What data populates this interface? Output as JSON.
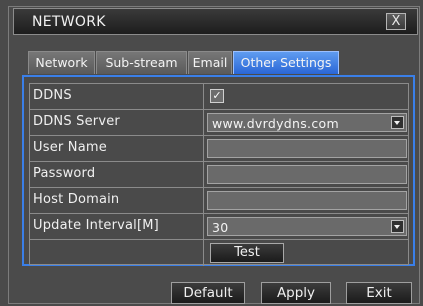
{
  "window": {
    "title": "NETWORK",
    "close_label": "X"
  },
  "tabs": [
    {
      "label": "Network",
      "active": false
    },
    {
      "label": "Sub-stream",
      "active": false
    },
    {
      "label": "Email",
      "active": false
    },
    {
      "label": "Other Settings",
      "active": true
    }
  ],
  "form": {
    "ddns_label": "DDNS",
    "ddns_checked": true,
    "ddns_check_glyph": "✓",
    "server_label": "DDNS Server",
    "server_value": "www.dvrdydns.com",
    "username_label": "User Name",
    "username_value": "",
    "password_label": "Password",
    "password_value": "",
    "host_label": "Host Domain",
    "host_value": "",
    "interval_label": "Update Interval[M]",
    "interval_value": "30",
    "test_label": "Test"
  },
  "buttons": {
    "default": "Default",
    "apply": "Apply",
    "exit": "Exit"
  },
  "colors": {
    "accent": "#3a7fe8",
    "tab_active": "#2a66d6",
    "panel_bg": "#4a4a4a"
  }
}
